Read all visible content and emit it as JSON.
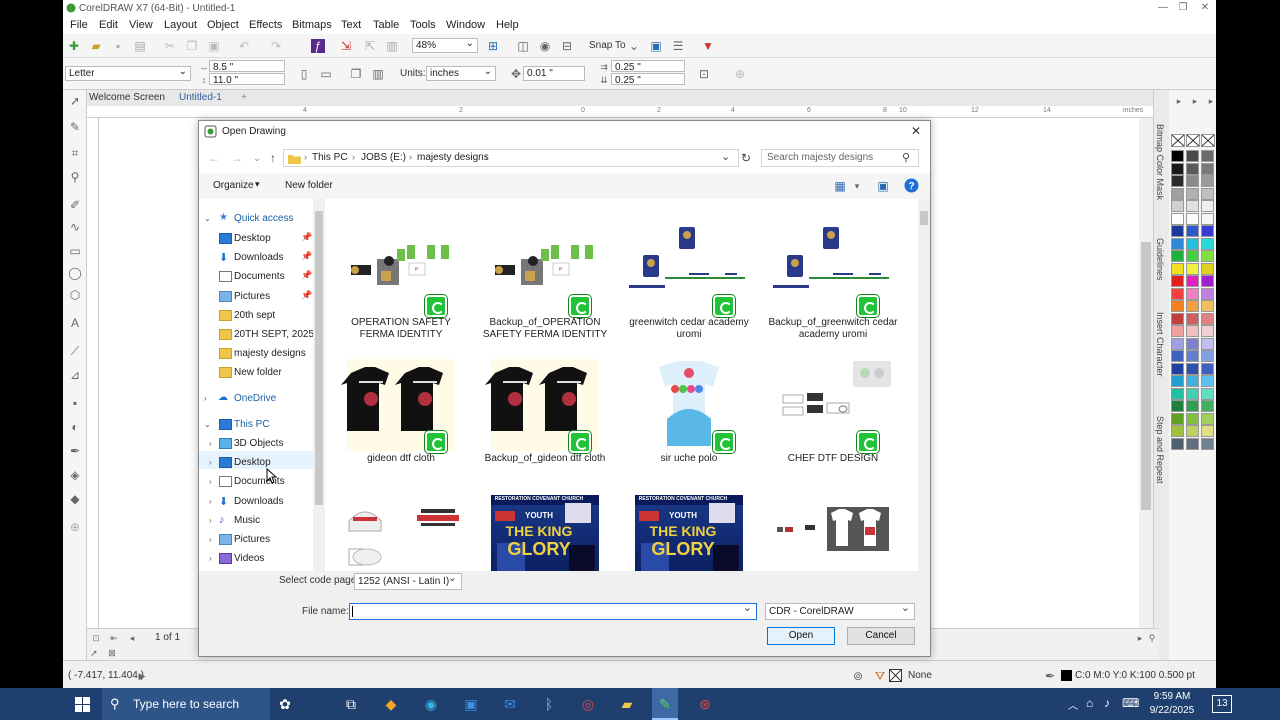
{
  "window": {
    "title": "CorelDRAW X7 (64-Bit) - Untitled-1"
  },
  "menu": [
    "File",
    "Edit",
    "View",
    "Layout",
    "Object",
    "Effects",
    "Bitmaps",
    "Text",
    "Table",
    "Tools",
    "Window",
    "Help"
  ],
  "toolbar": {
    "zoom": "48%",
    "snap_to": "Snap To"
  },
  "property_bar": {
    "page_size": "Letter",
    "width": "8.5 \"",
    "height": "11.0 \"",
    "units_label": "Units:",
    "units": "inches",
    "nudge": "0.01 \"",
    "dup_x": "0.25 \"",
    "dup_y": "0.25 \""
  },
  "doc_tabs": {
    "welcome": "Welcome Screen",
    "untitled": "Untitled-1"
  },
  "ruler": {
    "unit": "inches",
    "ticks": [
      "4",
      "2",
      "0",
      "2",
      "4",
      "6",
      "8",
      "10",
      "12",
      "14"
    ]
  },
  "docker_tabs": [
    "Bitmap Color Mask",
    "Guidelines",
    "Insert Character",
    "Step and Repeat"
  ],
  "page_nav": {
    "label": "1 of 1"
  },
  "status_bar": {
    "coords": "( -7.417, 11.404 )",
    "fill_none": "None",
    "outline": "C:0 M:0 Y:0 K:100  0.500 pt"
  },
  "dialog": {
    "title": "Open Drawing",
    "breadcrumb": [
      "This PC",
      "JOBS (E:)",
      "majesty designs"
    ],
    "search_placeholder": "Search majesty designs",
    "organize": "Organize",
    "new_folder": "New folder",
    "nav": {
      "quick_access": "Quick access",
      "quick_items": [
        {
          "label": "Desktop",
          "pinned": true,
          "icon": "desktop"
        },
        {
          "label": "Downloads",
          "pinned": true,
          "icon": "download"
        },
        {
          "label": "Documents",
          "pinned": true,
          "icon": "document"
        },
        {
          "label": "Pictures",
          "pinned": true,
          "icon": "picture"
        },
        {
          "label": "20th sept",
          "pinned": false,
          "icon": "folder"
        },
        {
          "label": "20TH SEPT, 2025",
          "pinned": false,
          "icon": "folder"
        },
        {
          "label": "majesty designs",
          "pinned": false,
          "icon": "folder"
        },
        {
          "label": "New folder",
          "pinned": false,
          "icon": "folder"
        }
      ],
      "onedrive": "OneDrive",
      "this_pc": "This PC",
      "pc_items": [
        {
          "label": "3D Objects",
          "icon": "3d"
        },
        {
          "label": "Desktop",
          "icon": "desktop"
        },
        {
          "label": "Documents",
          "icon": "document"
        },
        {
          "label": "Downloads",
          "icon": "download"
        },
        {
          "label": "Music",
          "icon": "music"
        },
        {
          "label": "Pictures",
          "icon": "picture"
        },
        {
          "label": "Videos",
          "icon": "video"
        }
      ]
    },
    "files": [
      {
        "name": "OPERATION SAFETY FERMA IDENTITY",
        "kind": "ids"
      },
      {
        "name": "Backup_of_OPERATION SAFETY FERMA IDENTITY",
        "kind": "ids"
      },
      {
        "name": "greenwitch cedar academy uromi",
        "kind": "academy"
      },
      {
        "name": "Backup_of_greenwitch cedar  academy uromi",
        "kind": "academy"
      },
      {
        "name": "gideon dtf cloth",
        "kind": "tshirts"
      },
      {
        "name": "Backup_of_gideon dtf cloth",
        "kind": "tshirts"
      },
      {
        "name": "sir uche polo",
        "kind": "polo"
      },
      {
        "name": "CHEF DTF DESIGN",
        "kind": "chef"
      },
      {
        "name": "",
        "kind": "cap"
      },
      {
        "name": "",
        "kind": "flyer"
      },
      {
        "name": "",
        "kind": "flyer"
      },
      {
        "name": "",
        "kind": "whiteshirts"
      }
    ],
    "flyer_text": {
      "church": "RESTORATION COVENANT CHURCH",
      "youth": "YOUTH",
      "headline": "THE KING",
      "sub": "GLORY"
    },
    "code_page_label": "Select code page",
    "code_page": "1252  (ANSI - Latin I)",
    "file_name_label": "File name:",
    "file_name": "",
    "file_type": "CDR - CorelDRAW",
    "open": "Open",
    "cancel": "Cancel"
  },
  "taskbar": {
    "search_placeholder": "Type here to search",
    "time": "9:59 AM",
    "date": "9/22/2025",
    "notifications": "13"
  }
}
